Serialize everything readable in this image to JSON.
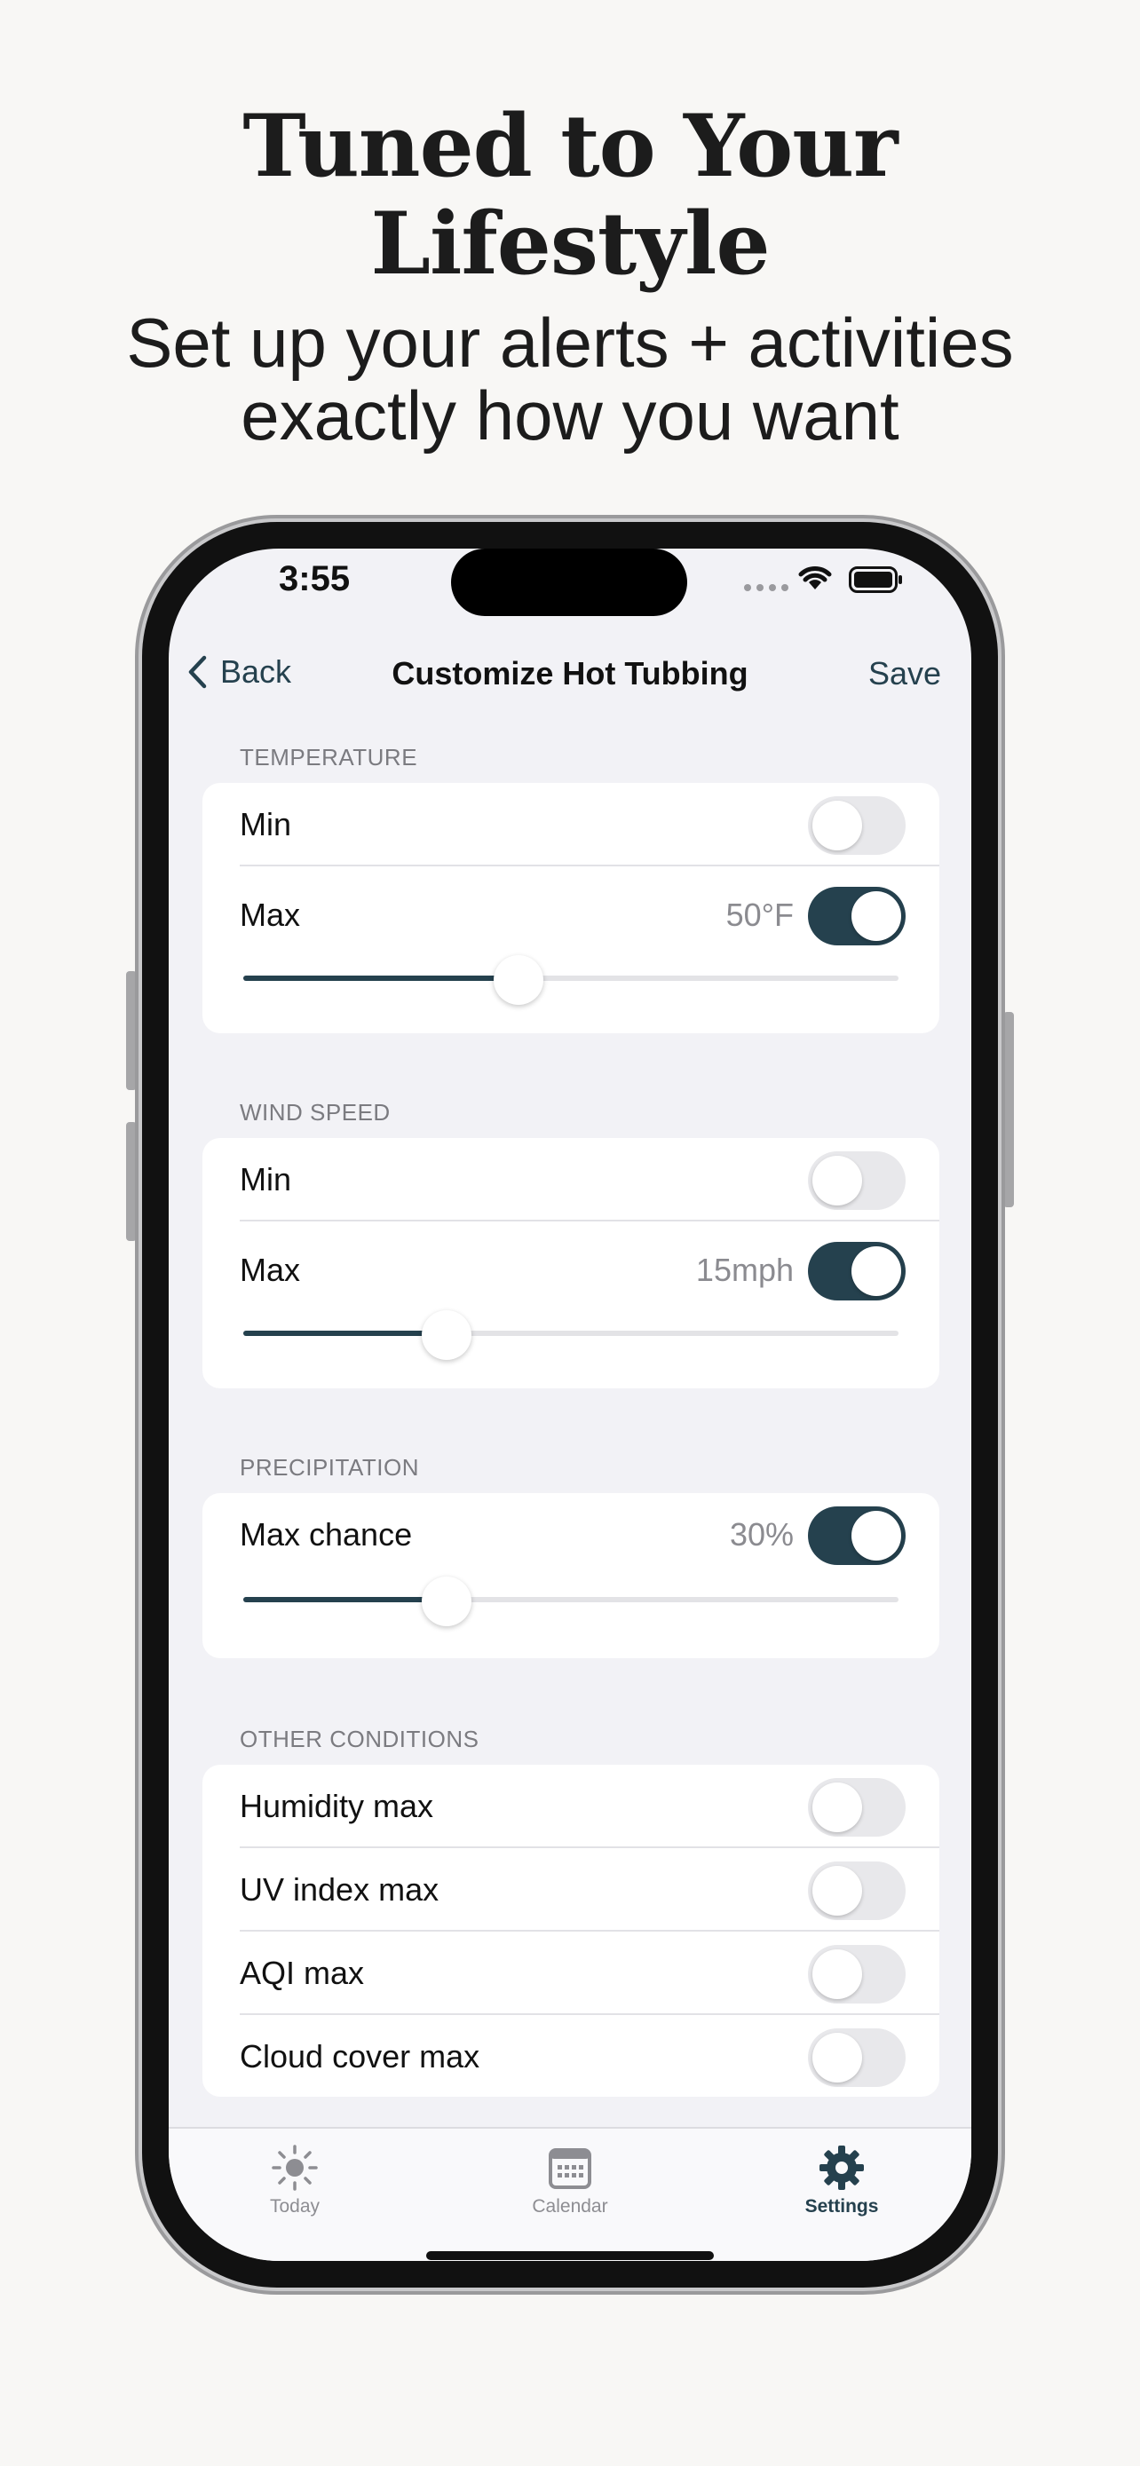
{
  "hero": {
    "title_line1": "Tuned to Your",
    "title_line2": "Lifestyle",
    "subtitle_line1": "Set up your alerts + activities",
    "subtitle_line2": "exactly how you want"
  },
  "status_bar": {
    "time": "3:55"
  },
  "nav": {
    "back_label": "Back",
    "title": "Customize Hot Tubbing",
    "save_label": "Save"
  },
  "sections": {
    "temperature": {
      "header": "TEMPERATURE",
      "min_label": "Min",
      "min_enabled": false,
      "max_label": "Max",
      "max_value": "50°F",
      "max_enabled": true,
      "slider_fraction": 0.42
    },
    "wind_speed": {
      "header": "WIND SPEED",
      "min_label": "Min",
      "min_enabled": false,
      "max_label": "Max",
      "max_value": "15mph",
      "max_enabled": true,
      "slider_fraction": 0.31
    },
    "precipitation": {
      "header": "PRECIPITATION",
      "max_label": "Max chance",
      "max_value": "30%",
      "max_enabled": true,
      "slider_fraction": 0.31
    },
    "other": {
      "header": "OTHER CONDITIONS",
      "items": [
        {
          "label": "Humidity max",
          "enabled": false
        },
        {
          "label": "UV index max",
          "enabled": false
        },
        {
          "label": "AQI max",
          "enabled": false
        },
        {
          "label": "Cloud cover max",
          "enabled": false
        }
      ]
    }
  },
  "tabbar": {
    "tabs": [
      {
        "label": "Today",
        "icon": "sun-icon",
        "active": false
      },
      {
        "label": "Calendar",
        "icon": "calendar-icon",
        "active": false
      },
      {
        "label": "Settings",
        "icon": "gear-icon",
        "active": true
      }
    ]
  },
  "colors": {
    "accent": "#25414e",
    "background": "#f2f2f6",
    "page": "#f8f7f5"
  }
}
